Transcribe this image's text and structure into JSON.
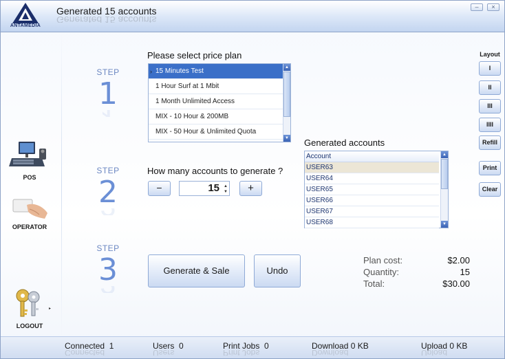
{
  "window": {
    "title": "Generated 15 accounts",
    "logo_text": "ANTAMEDIA",
    "minimize_glyph": "–",
    "close_glyph": "×"
  },
  "sidebar": {
    "items": [
      {
        "label": "POS",
        "icon": "pos-terminal-icon"
      },
      {
        "label": "OPERATOR",
        "icon": "operator-card-icon"
      },
      {
        "label": "LOGOUT",
        "icon": "keys-icon"
      }
    ]
  },
  "steps": [
    {
      "word": "STEP",
      "number": "1"
    },
    {
      "word": "STEP",
      "number": "2"
    },
    {
      "word": "STEP",
      "number": "3"
    }
  ],
  "plan": {
    "label": "Please select price plan",
    "items": [
      "15 Minutes Test",
      "1 Hour Surf at 1 Mbit",
      "1 Month Unlimited Access",
      "MIX - 10 Hour & 200MB",
      "MIX - 50 Hour & Unlimited Quota"
    ],
    "selected_index": 0
  },
  "quantity": {
    "label": "How many accounts to generate ?",
    "value": "15",
    "minus_glyph": "−",
    "plus_glyph": "+"
  },
  "accounts": {
    "label": "Generated accounts",
    "column_header": "Account",
    "rows": [
      "USER63",
      "USER64",
      "USER65",
      "USER66",
      "USER67",
      "USER68"
    ]
  },
  "actions": {
    "generate_label": "Generate & Sale",
    "undo_label": "Undo"
  },
  "summary": {
    "plan_cost_label": "Plan cost:",
    "plan_cost_value": "$2.00",
    "quantity_label": "Quantity:",
    "quantity_value": "15",
    "total_label": "Total:",
    "total_value": "$30.00"
  },
  "right_panel": {
    "layout_label": "Layout",
    "layout_buttons": [
      "I",
      "II",
      "III",
      "IIII"
    ],
    "refill_label": "Refill",
    "print_label": "Print",
    "clear_label": "Clear"
  },
  "statusbar": {
    "connected_label": "Connected",
    "connected_value": "1",
    "users_label": "Users",
    "users_value": "0",
    "print_jobs_label": "Print Jobs",
    "print_jobs_value": "0",
    "download_label": "Download",
    "download_value": "0 KB",
    "upload_label": "Upload",
    "upload_value": "0 KB"
  },
  "colors": {
    "accent": "#3a6fc8",
    "step_blue": "#6b8fd6",
    "title_gradient_end": "#c3d5f0"
  }
}
